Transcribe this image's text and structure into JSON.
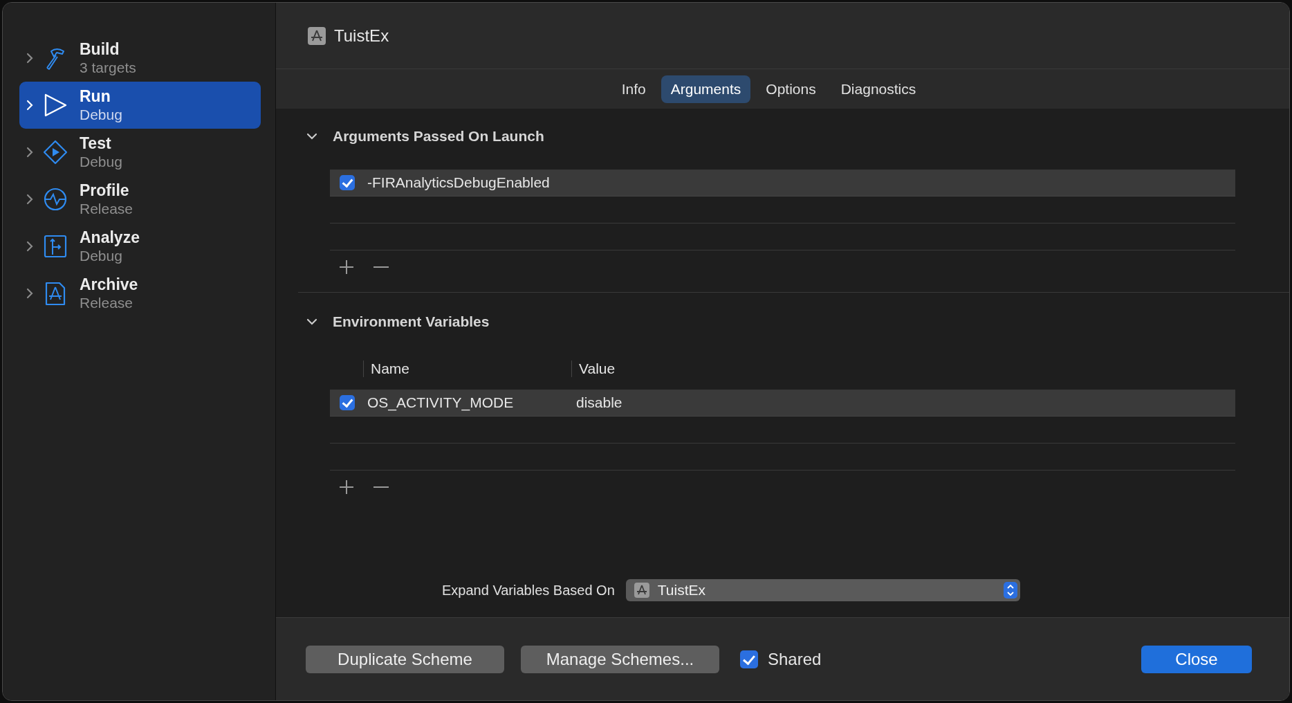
{
  "sidebar": {
    "items": [
      {
        "kind": "build",
        "title": "Build",
        "subtitle": "3 targets",
        "selected": false
      },
      {
        "kind": "run",
        "title": "Run",
        "subtitle": "Debug",
        "selected": true
      },
      {
        "kind": "test",
        "title": "Test",
        "subtitle": "Debug",
        "selected": false
      },
      {
        "kind": "profile",
        "title": "Profile",
        "subtitle": "Release",
        "selected": false
      },
      {
        "kind": "analyze",
        "title": "Analyze",
        "subtitle": "Debug",
        "selected": false
      },
      {
        "kind": "archive",
        "title": "Archive",
        "subtitle": "Release",
        "selected": false
      }
    ]
  },
  "header": {
    "title": "TuistEx"
  },
  "tabs": [
    {
      "label": "Info",
      "selected": false
    },
    {
      "label": "Arguments",
      "selected": true
    },
    {
      "label": "Options",
      "selected": false
    },
    {
      "label": "Diagnostics",
      "selected": false
    }
  ],
  "arguments": {
    "title": "Arguments Passed On Launch",
    "expanded": true,
    "rows": [
      {
        "checked": true,
        "value": "-FIRAnalyticsDebugEnabled"
      }
    ]
  },
  "environment": {
    "title": "Environment Variables",
    "expanded": true,
    "columns": [
      "Name",
      "Value"
    ],
    "rows": [
      {
        "checked": true,
        "name": "OS_ACTIVITY_MODE",
        "value": "disable"
      }
    ]
  },
  "expand_variables": {
    "label": "Expand Variables Based On",
    "value": "TuistEx"
  },
  "footer": {
    "duplicate": "Duplicate Scheme",
    "manage": "Manage Schemes...",
    "shared": {
      "label": "Shared",
      "checked": true
    },
    "close": "Close"
  }
}
